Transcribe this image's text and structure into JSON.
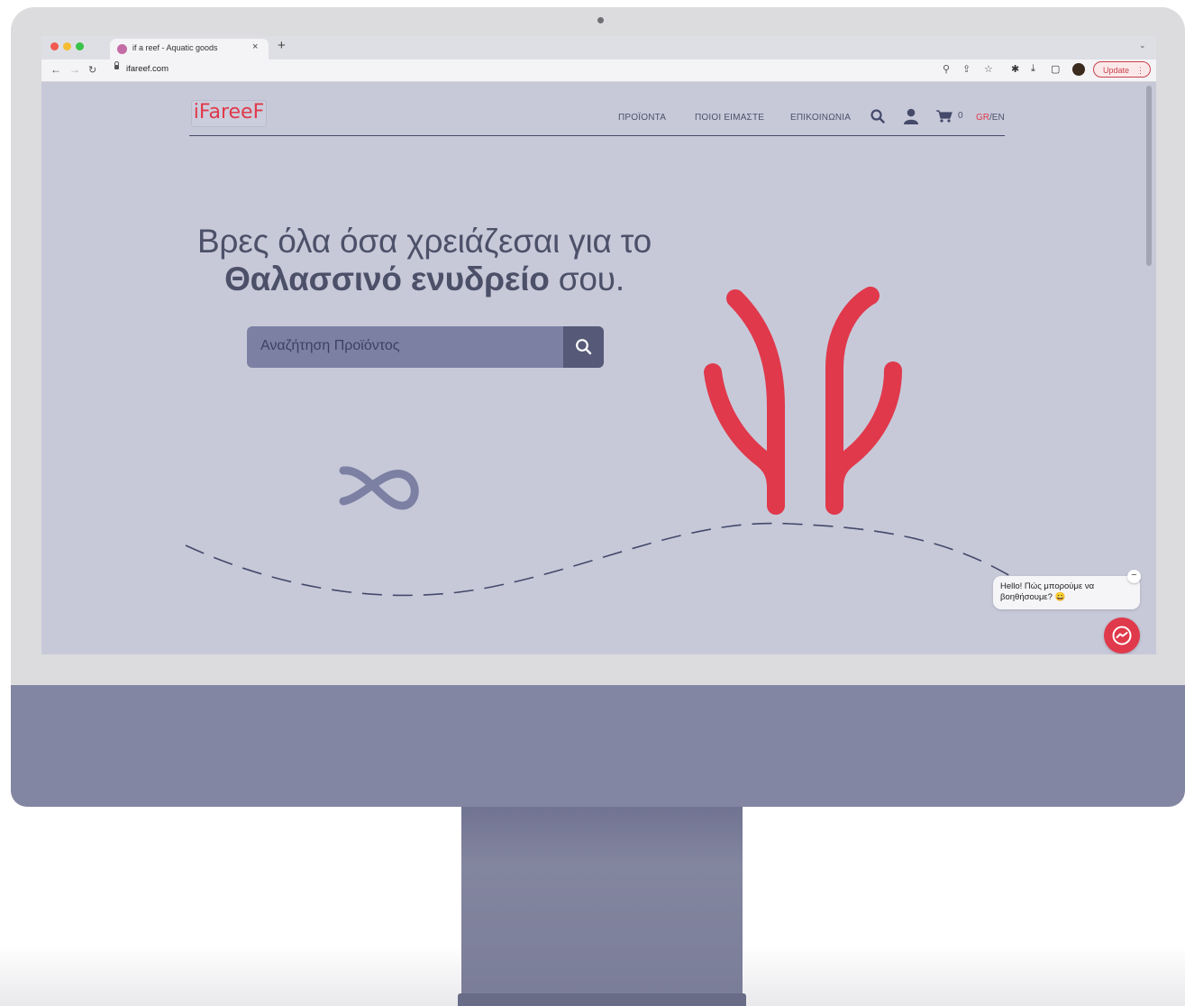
{
  "browser": {
    "tab_title": "if a reef - Aquatic goods",
    "tab_close": "×",
    "new_tab": "+",
    "url": "ifareef.com",
    "update_label": "Update"
  },
  "site": {
    "logo_text": "iFareeF",
    "nav": {
      "products": "ΠΡΟΪΟΝΤΑ",
      "about": "ΠΟΙΟΙ ΕΙΜΑΣΤΕ",
      "contact": "ΕΠΙΚΟΙΝΩΝΙΑ"
    },
    "cart_count": "0",
    "lang_gr": "GR",
    "lang_sep": "/",
    "lang_en": "EN"
  },
  "hero": {
    "headline_line1": "Βρες όλα όσα χρειάζεσαι για το",
    "headline_bold": "Θαλασσινό ενυδρείο",
    "headline_end": " σου.",
    "search_placeholder": "Αναζήτηση Προϊόντος"
  },
  "chat": {
    "message": "Hello! Πώς μπορούμε να βοηθήσουμε? 😀",
    "close_label": "−"
  },
  "colors": {
    "accent": "#e0394b",
    "page_bg": "#c7c9d9",
    "text": "#4c5068",
    "search_bg": "#7c80a3"
  }
}
